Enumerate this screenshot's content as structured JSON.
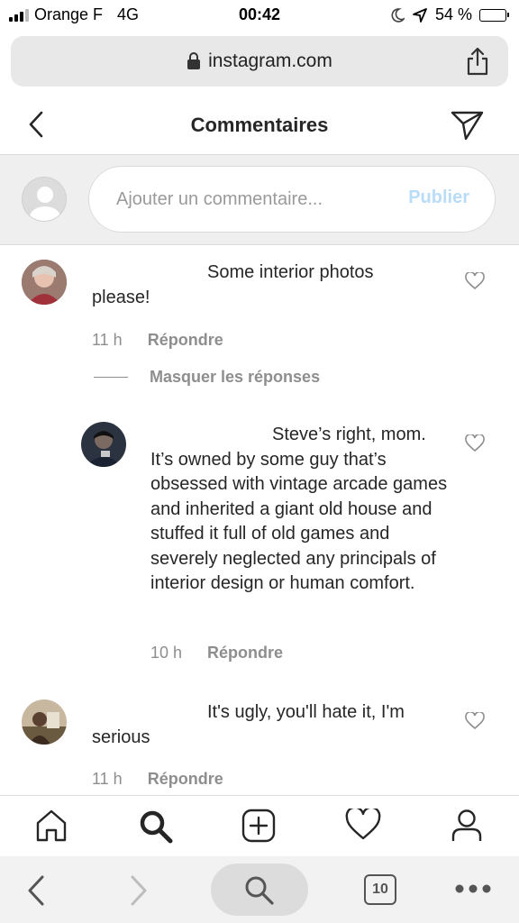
{
  "status_bar": {
    "carrier": "Orange F",
    "network": "4G",
    "time": "00:42",
    "battery": "54 %",
    "battery_level": 0.54
  },
  "browser": {
    "url": "instagram.com",
    "tab_count": "10"
  },
  "header": {
    "title": "Commentaires"
  },
  "compose": {
    "placeholder": "Ajouter un commentaire...",
    "publish_label": "Publier"
  },
  "comments": [
    {
      "text": "Some interior photos please!",
      "time": "11 h",
      "reply_label": "Répondre",
      "hide_replies_label": "Masquer les réponses",
      "replies": [
        {
          "text": "Steve’s right, mom. It’s owned by some guy that’s obsessed with vintage arcade games and inherited a giant old house and stuffed it full of old games and severely neglected any principals of interior design or human comfort.",
          "time": "10 h",
          "reply_label": "Répondre"
        }
      ]
    },
    {
      "text": "It's ugly, you'll hate it, I'm serious",
      "time": "11 h",
      "reply_label": "Répondre"
    }
  ],
  "colors": {
    "publish_disabled": "#b9dcf7",
    "meta_gray": "#8e8e8e",
    "divider": "#dbdbdb"
  },
  "icons": {
    "nav": [
      "home-icon",
      "search-icon",
      "new-post-icon",
      "activity-heart-icon",
      "profile-icon"
    ],
    "safari": [
      "back-arrow-icon",
      "forward-arrow-icon",
      "search-icon",
      "tabs-icon",
      "more-icon"
    ]
  }
}
